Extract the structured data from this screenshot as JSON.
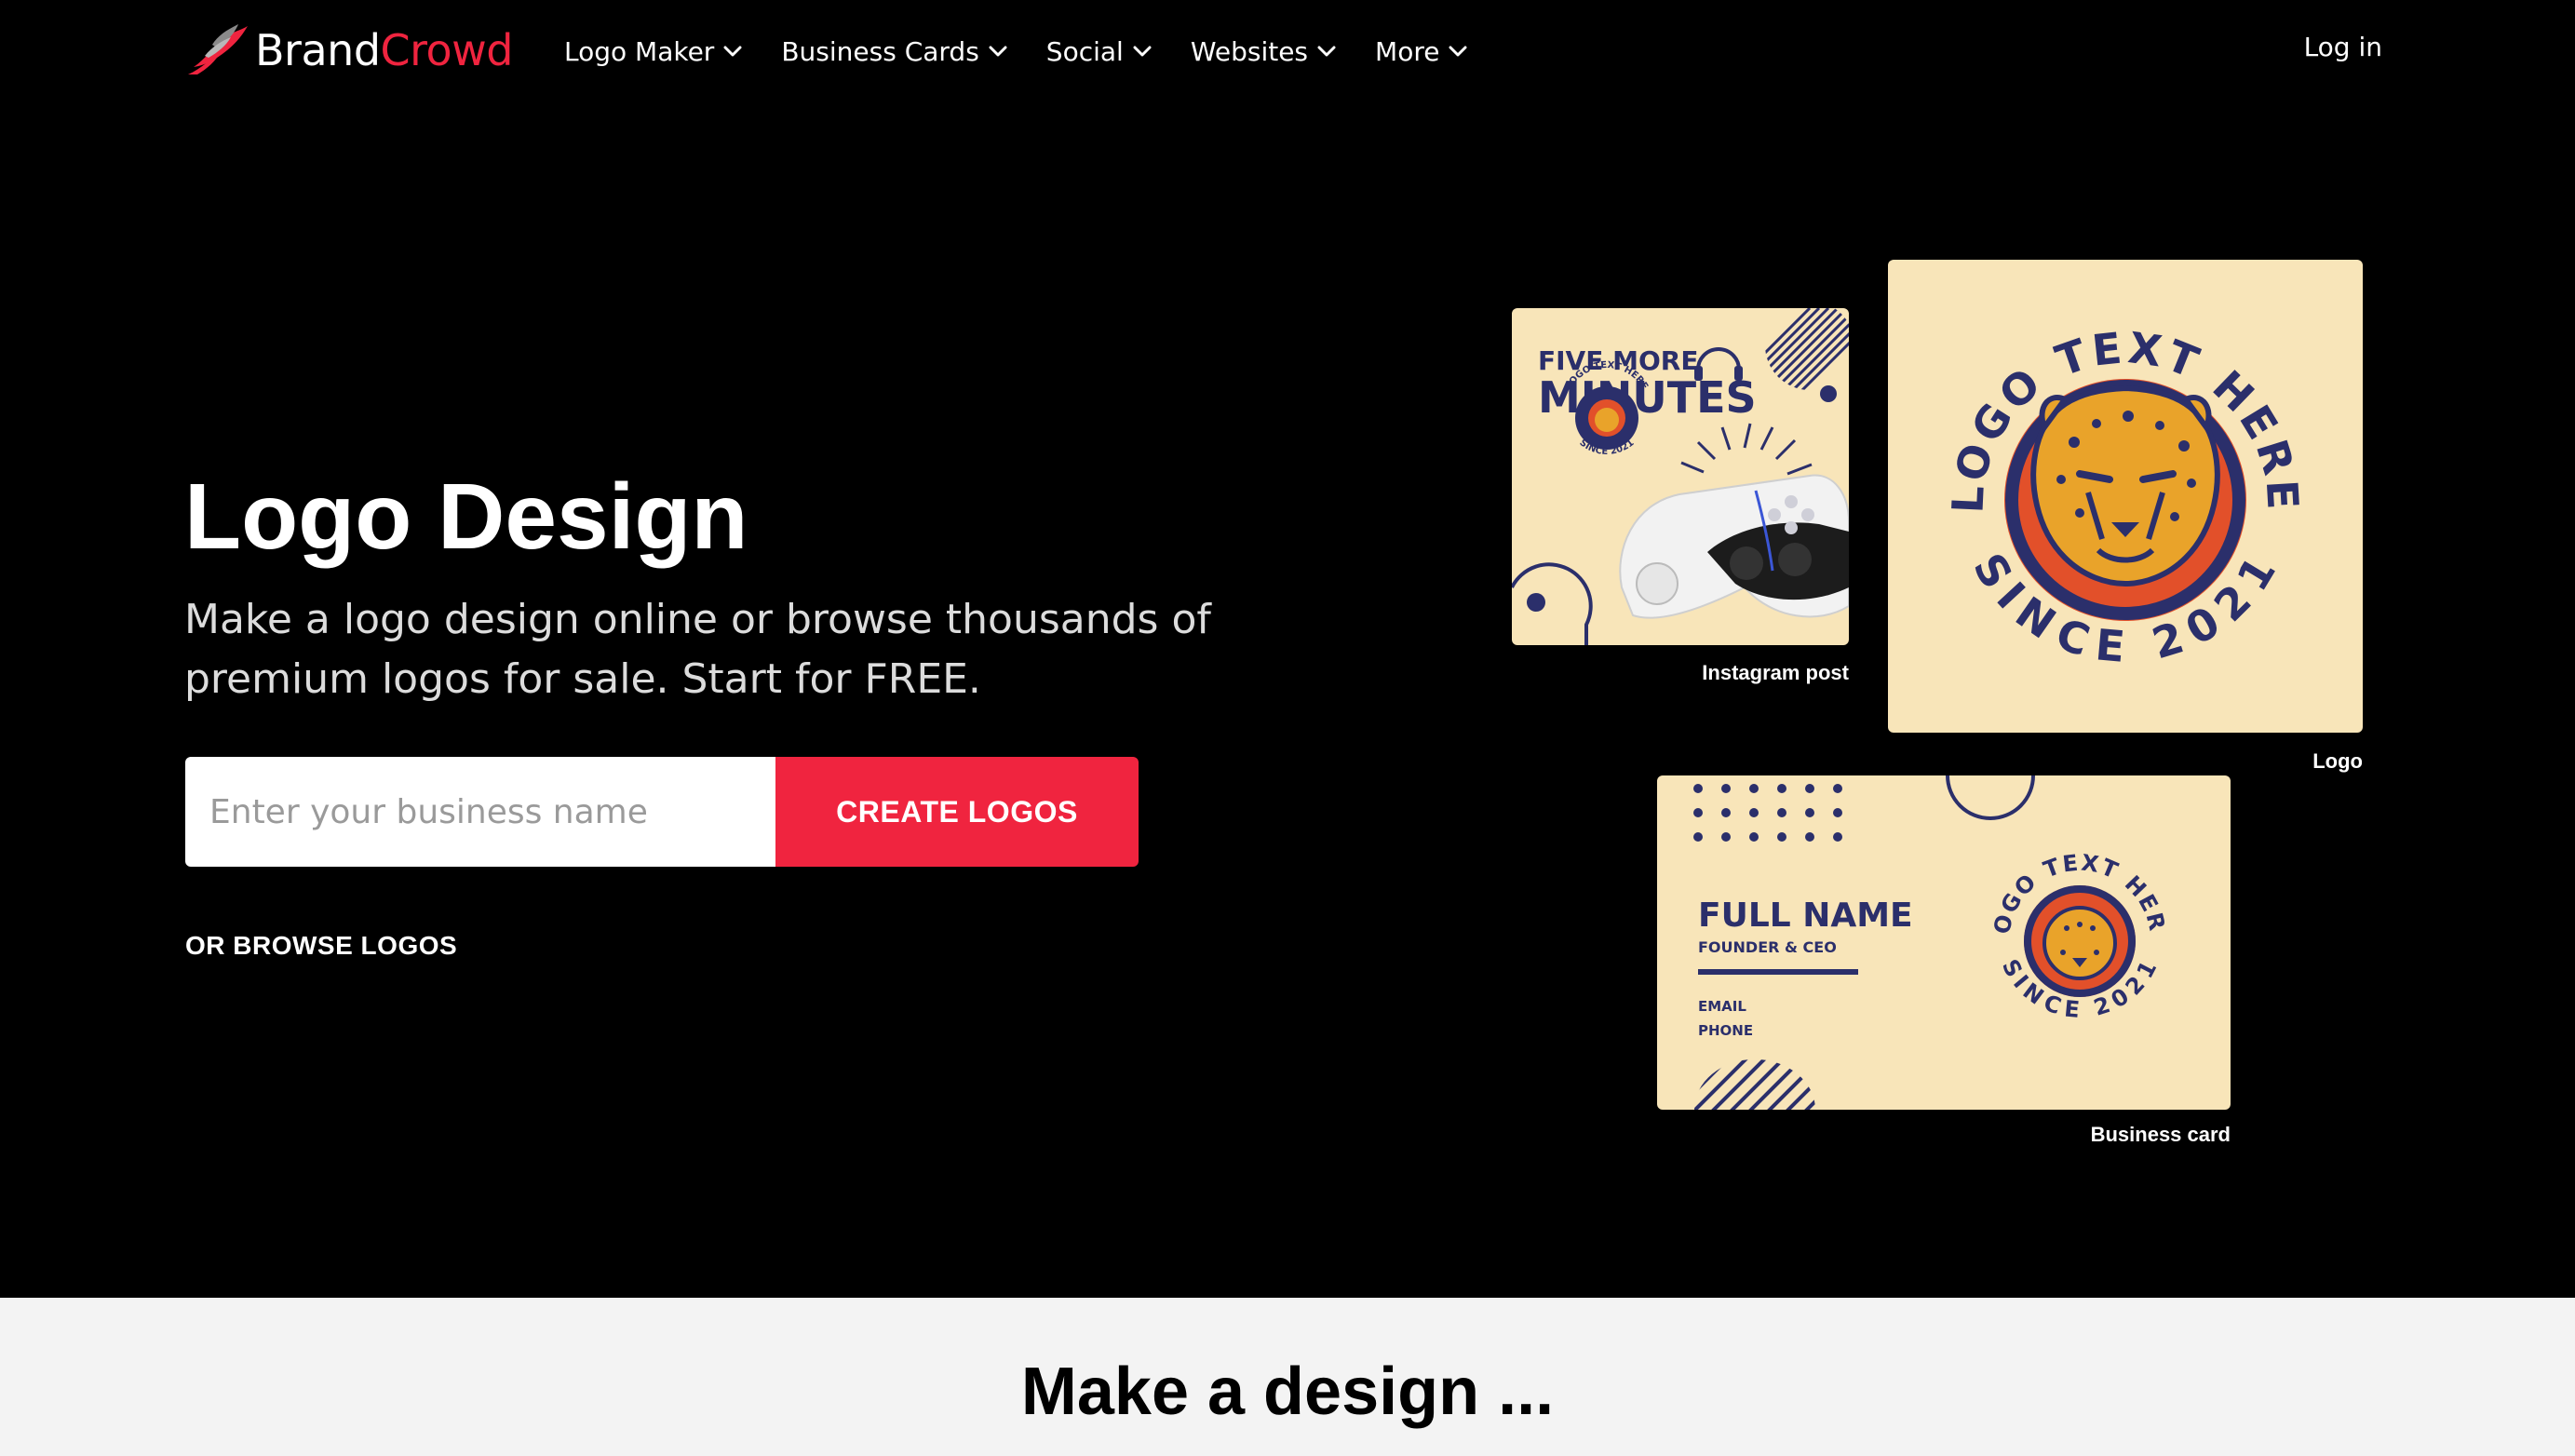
{
  "brand": {
    "part1": "Brand",
    "part2": "Crowd",
    "accent": "#f0243f"
  },
  "nav": {
    "items": [
      {
        "label": "Logo Maker"
      },
      {
        "label": "Business Cards"
      },
      {
        "label": "Social"
      },
      {
        "label": "Websites"
      },
      {
        "label": "More"
      }
    ],
    "login": "Log in",
    "dropdown_icon": "chevron-down-icon"
  },
  "hero": {
    "title": "Logo Design",
    "subtitle_line1": "Make a logo design online or browse thousands of",
    "subtitle_line2": "premium logos for sale. Start for FREE.",
    "input_placeholder": "Enter your business name",
    "input_value": "",
    "cta": "CREATE LOGOS",
    "browse": "OR BROWSE LOGOS"
  },
  "mockups": {
    "instagram": {
      "caption": "Instagram post",
      "line1": "FIVE MORE",
      "line2": "MINUTES",
      "badge_top": "LOGO TEXT HERE",
      "badge_bottom": "SINCE 2021"
    },
    "logo": {
      "caption": "Logo",
      "top_text": "LOGO TEXT HERE",
      "bottom_text": "SINCE 2021"
    },
    "business_card": {
      "caption": "Business card",
      "name": "FULL NAME",
      "role": "FOUNDER & CEO",
      "email": "EMAIL",
      "phone": "PHONE",
      "badge_top": "LOGO TEXT HERE",
      "badge_bottom": "SINCE 2021"
    },
    "colors": {
      "cream": "#f8e5b9",
      "navy": "#2b2f6b",
      "orange": "#e2502a",
      "gold": "#e9a32a"
    }
  },
  "section": {
    "heading": "Make a design ..."
  }
}
